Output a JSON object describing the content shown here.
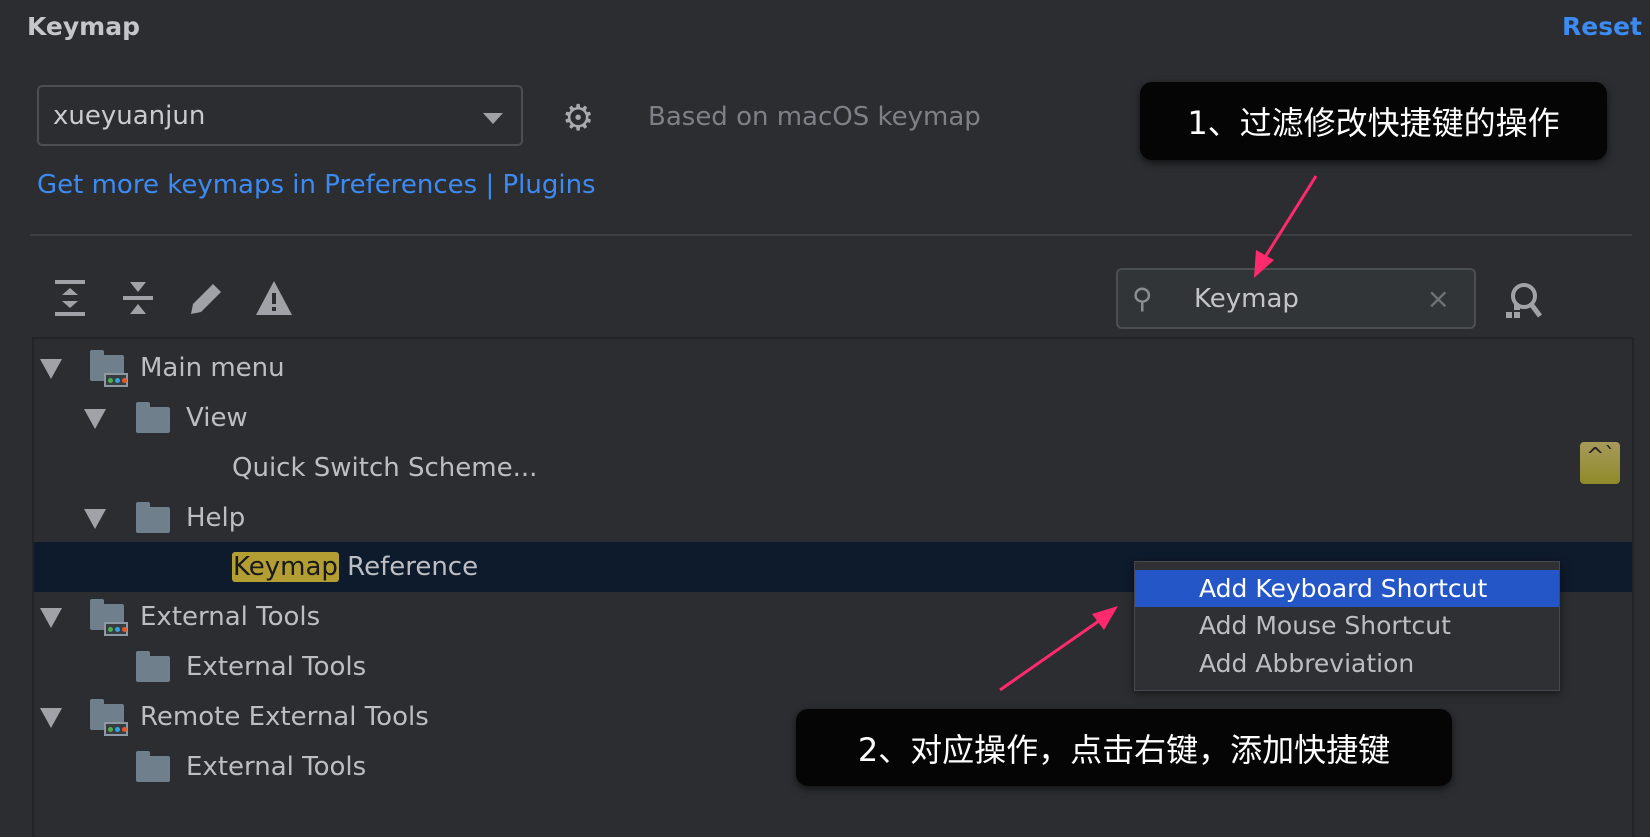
{
  "header": {
    "title": "Keymap",
    "reset_label": "Reset"
  },
  "keymap": {
    "selected": "xueyuanjun",
    "based_on": "Based on macOS keymap",
    "more_link": "Get more keymaps in Preferences | Plugins"
  },
  "toolbar": {
    "icons": [
      "expand-all-icon",
      "collapse-all-icon",
      "edit-icon",
      "warning-icon"
    ]
  },
  "search": {
    "value": "Keymap",
    "clear": "×"
  },
  "tree": {
    "main_menu": "Main menu",
    "view": "View",
    "quick_switch": "Quick Switch Scheme...",
    "quick_switch_shortcut": "^`",
    "help": "Help",
    "keymap_ref_match": "Keymap",
    "keymap_ref_rest": " Reference",
    "external_tools": "External Tools",
    "external_tools_child": "External Tools",
    "remote_external_tools": "Remote External Tools",
    "remote_external_tools_child": "External Tools"
  },
  "context_menu": {
    "items": [
      "Add Keyboard Shortcut",
      "Add Mouse Shortcut",
      "Add Abbreviation"
    ]
  },
  "annotations": {
    "callout1": "1、过滤修改快捷键的操作",
    "callout2": "2、对应操作，点击右键，添加快捷键"
  },
  "colors": {
    "accent": "#3d8bf2",
    "selection": "#0e1b2c",
    "menu_highlight": "#2456c8",
    "match_highlight": "#b39e33",
    "arrow": "#ff2a6d"
  }
}
